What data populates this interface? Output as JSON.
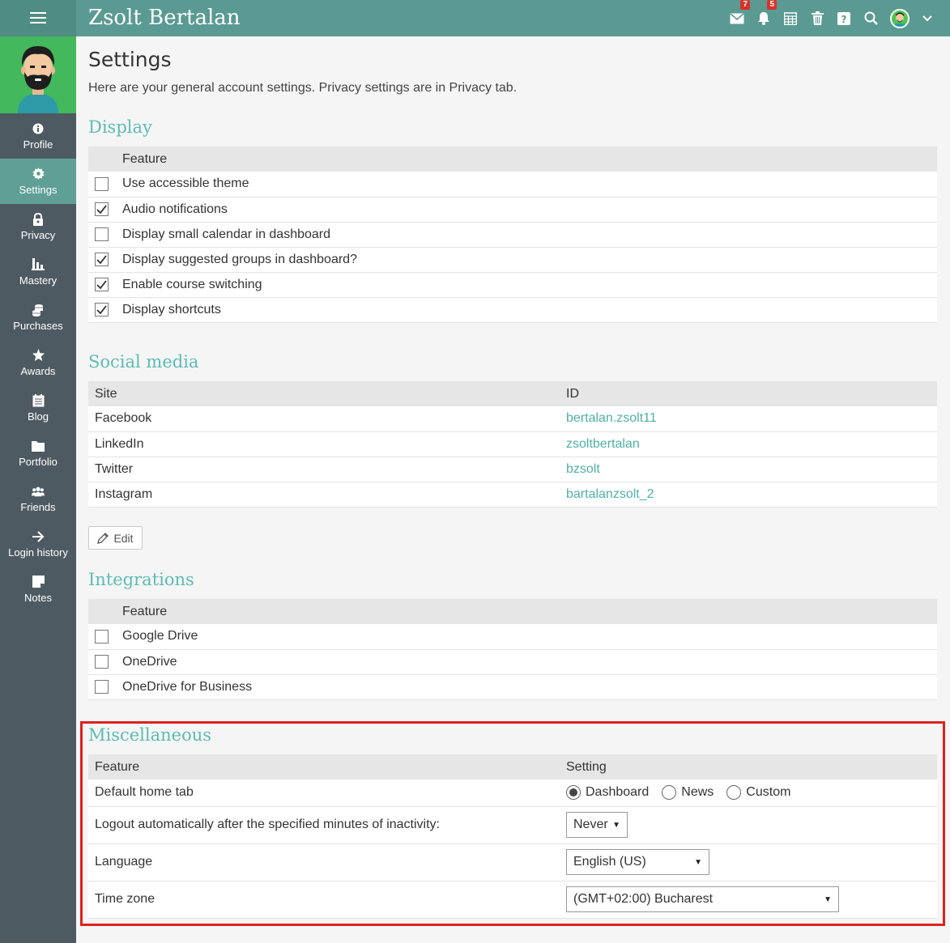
{
  "header": {
    "title": "Zsolt Bertalan",
    "mail_badge": "7",
    "notifications_badge": "5"
  },
  "sidebar": {
    "items": [
      {
        "label": "Profile"
      },
      {
        "label": "Settings"
      },
      {
        "label": "Privacy"
      },
      {
        "label": "Mastery"
      },
      {
        "label": "Purchases"
      },
      {
        "label": "Awards"
      },
      {
        "label": "Blog"
      },
      {
        "label": "Portfolio"
      },
      {
        "label": "Friends"
      },
      {
        "label": "Login history"
      },
      {
        "label": "Notes"
      }
    ],
    "active": "Settings"
  },
  "page": {
    "title": "Settings",
    "description": "Here are your general account settings. Privacy settings are in Privacy tab."
  },
  "display": {
    "title": "Display",
    "header": "Feature",
    "rows": [
      {
        "label": "Use accessible theme",
        "checked": false
      },
      {
        "label": "Audio notifications",
        "checked": true
      },
      {
        "label": "Display small calendar in dashboard",
        "checked": false
      },
      {
        "label": "Display suggested groups in dashboard?",
        "checked": true
      },
      {
        "label": "Enable course switching",
        "checked": true
      },
      {
        "label": "Display shortcuts",
        "checked": true
      }
    ]
  },
  "social": {
    "title": "Social media",
    "headers": [
      "Site",
      "ID"
    ],
    "rows": [
      {
        "site": "Facebook",
        "id": "bertalan.zsolt11"
      },
      {
        "site": "LinkedIn",
        "id": "zsoltbertalan"
      },
      {
        "site": "Twitter",
        "id": "bzsolt"
      },
      {
        "site": "Instagram",
        "id": "bartalanzsolt_2"
      }
    ],
    "edit_label": "Edit"
  },
  "integrations": {
    "title": "Integrations",
    "header": "Feature",
    "rows": [
      {
        "label": "Google Drive",
        "checked": false
      },
      {
        "label": "OneDrive",
        "checked": false
      },
      {
        "label": "OneDrive for Business",
        "checked": false
      }
    ]
  },
  "misc": {
    "title": "Miscellaneous",
    "headers": [
      "Feature",
      "Setting"
    ],
    "home_tab": {
      "label": "Default home tab",
      "options": [
        "Dashboard",
        "News",
        "Custom"
      ],
      "selected": "Dashboard"
    },
    "logout": {
      "label": "Logout automatically after the specified minutes of inactivity:",
      "value": "Never"
    },
    "language": {
      "label": "Language",
      "value": "English (US)"
    },
    "timezone": {
      "label": "Time zone",
      "value": "(GMT+02:00) Bucharest"
    }
  },
  "colors": {
    "topbar": "#5a9a92",
    "sidebar": "#4e5a62",
    "accent": "#5bbcb4",
    "highlight_box": "#e02020"
  }
}
